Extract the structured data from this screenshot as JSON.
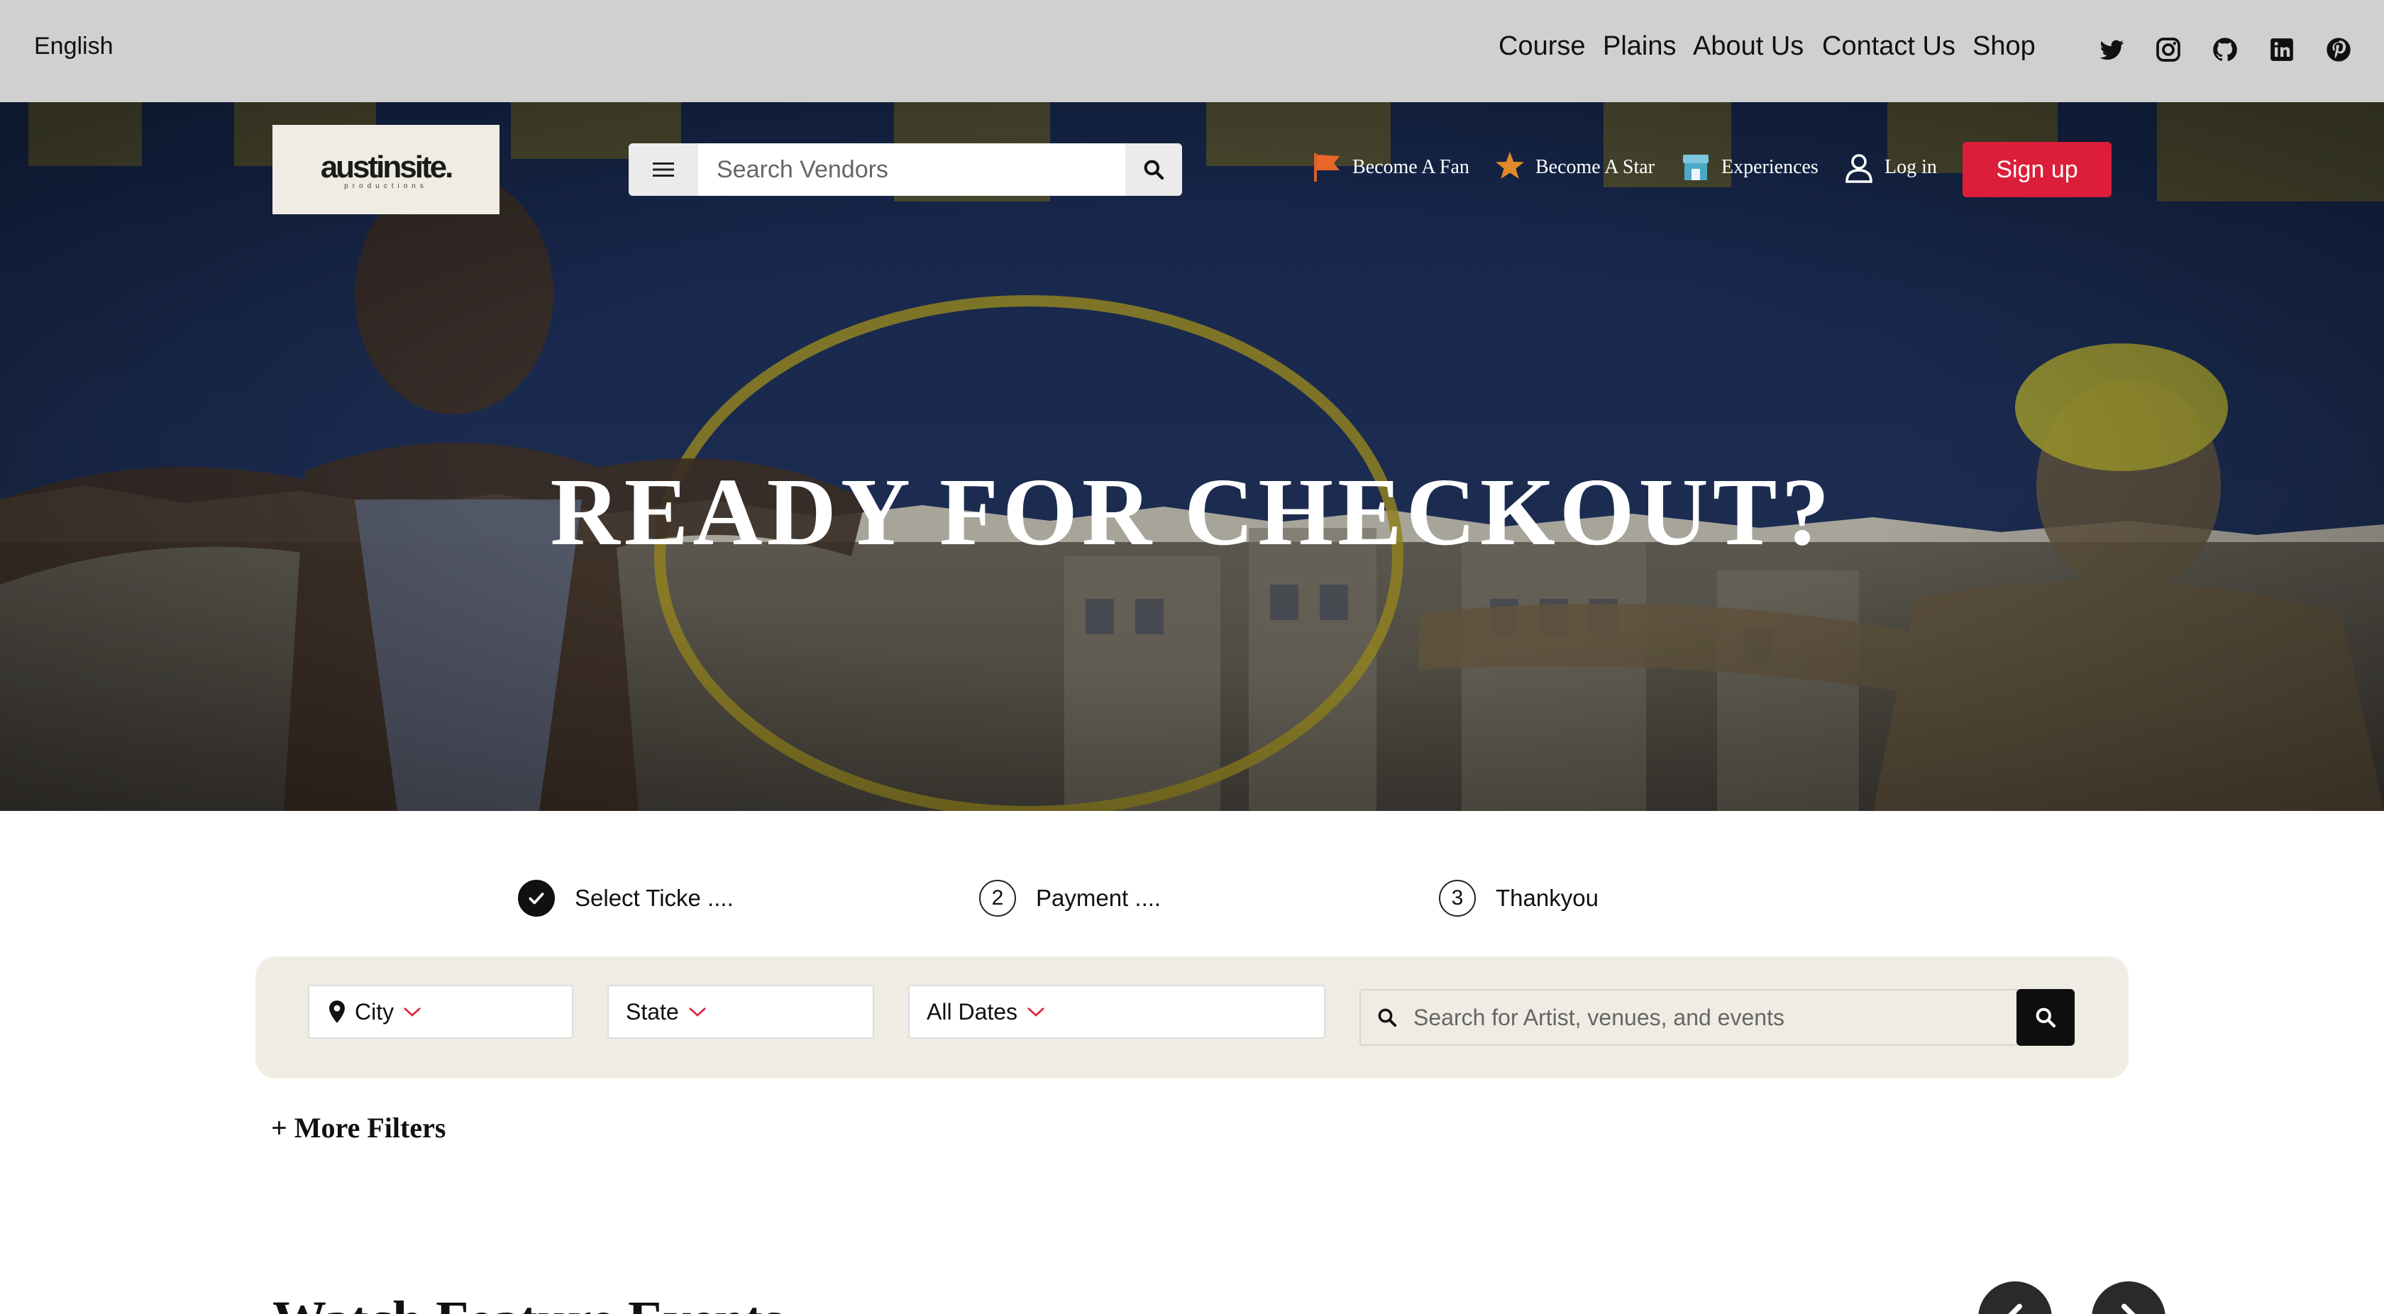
{
  "topbar": {
    "language": "English",
    "nav": [
      "Course",
      "Plains",
      "About Us",
      "Contact Us",
      "Shop"
    ],
    "social_icons": [
      "twitter-icon",
      "instagram-icon",
      "github-icon",
      "linkedin-icon",
      "pinterest-icon"
    ]
  },
  "header": {
    "logo_text": "austinsite.",
    "logo_subtext": "productions",
    "search_placeholder": "Search Vendors",
    "nav": [
      {
        "label": "Become A Fan",
        "icon": "flag-icon"
      },
      {
        "label": "Become A Star",
        "icon": "star-icon"
      },
      {
        "label": "Experiences",
        "icon": "store-icon"
      },
      {
        "label": "Log in",
        "icon": "user-icon"
      }
    ],
    "signup_label": "Sign up"
  },
  "hero": {
    "title": "READY FOR CHECKOUT?"
  },
  "steps": [
    {
      "number": "",
      "label": "Select Ticke ....",
      "done": true
    },
    {
      "number": "2",
      "label": "Payment ....",
      "done": false
    },
    {
      "number": "3",
      "label": "Thankyou",
      "done": false
    }
  ],
  "filters": {
    "city_label": "City",
    "state_label": "State",
    "dates_label": "All Dates",
    "search_placeholder": "Search for Artist, venues, and events"
  },
  "more_filters_label": "+ More Filters",
  "section": {
    "title": "Watch Feature Events"
  },
  "colors": {
    "topbar_bg": "#d0d0d0",
    "hero_navy": "#1d3361",
    "accent_red": "#dc1e3a",
    "filter_panel_bg": "#efece4",
    "logo_bg": "#efece4"
  }
}
